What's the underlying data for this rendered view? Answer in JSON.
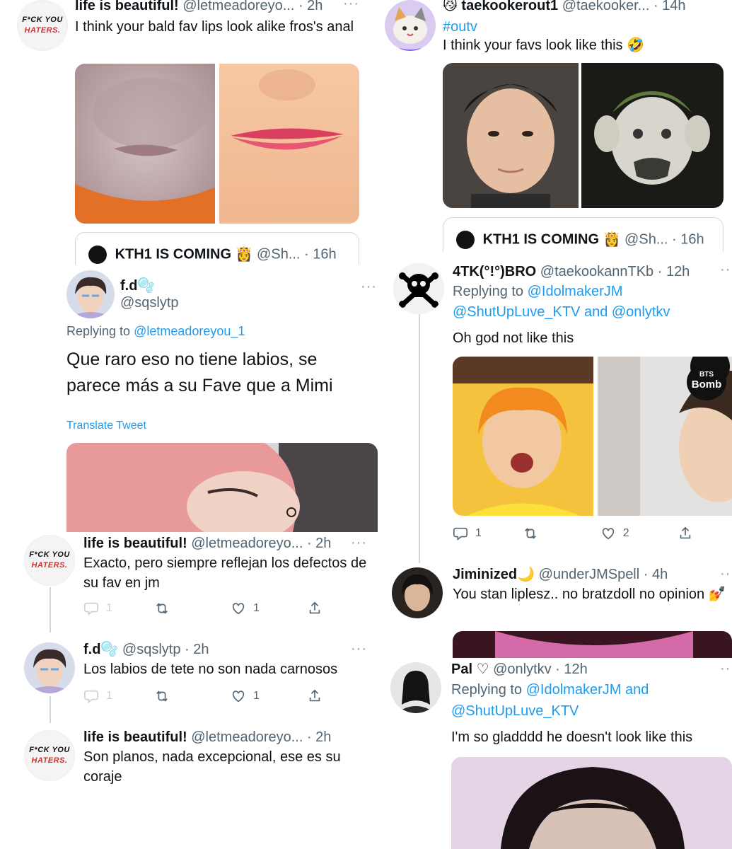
{
  "top_left": {
    "avatar_line1": "F*CK YOU",
    "avatar_line2": "HATERS.",
    "name": "life is beautiful!",
    "handle": "@letmeadoreyo... · 2h",
    "text": "I think your bald fav lips look alike fros's anal",
    "quote_name": "KTH1 IS COMING 👸",
    "quote_handle": "@Sh... · 16h"
  },
  "top_right": {
    "name": "😼 taekookerout1",
    "handle": "@taekooker... · 14h",
    "hashtag": "#outv",
    "text": "I think your favs  look like this 🤣",
    "quote_name": "KTH1 IS COMING 👸",
    "quote_handle": "@Sh... · 16h"
  },
  "mid_left": {
    "name": "f.d⁠🫧",
    "handle": "@sqslytp",
    "replying_prefix": "Replying to ",
    "replying_to": "@letmeadoreyou_1",
    "text": "Que raro eso no tiene labios, se parece más a su Fave que a Mimi",
    "translate": "Translate Tweet"
  },
  "mid_right": {
    "name": "4TK(°!°)BRO",
    "handle": "@taekookannTKb · 12h",
    "replying_prefix": "Replying to ",
    "replying_to_line1": "@IdolmakerJM",
    "replying_to_line2": "@ShutUpLuve_KTV and @onlytkv",
    "text": "Oh god not like this",
    "badge_line1": "BTS",
    "badge_line2": "Bomb",
    "reply_count": "1",
    "retweet_count": "",
    "like_count": "2"
  },
  "thread_left": [
    {
      "avatar_line1": "F*CK YOU",
      "avatar_line2": "HATERS.",
      "name": "life is beautiful!",
      "handle": "@letmeadoreyo... · 2h",
      "text": "Exacto, pero siempre reflejan los defectos de su fav en jm",
      "reply_count": "1",
      "like_count": "1"
    },
    {
      "name": "f.d🫧",
      "handle": "@sqslytp · 2h",
      "text": "Los labios de tete no son nada carnosos",
      "reply_count": "1",
      "like_count": "1"
    },
    {
      "avatar_line1": "F*CK YOU",
      "avatar_line2": "HATERS.",
      "name": "life is beautiful!",
      "handle": "@letmeadoreyo... · 2h",
      "text": "Son planos, nada excepcional, ese es su coraje"
    }
  ],
  "bottom_right": [
    {
      "name": "Jiminized🌙",
      "handle": "@underJMSpell · 4h",
      "text": "You stan liplesz.. no bratzdoll no opinion 💅"
    },
    {
      "name": "Pal ♡",
      "handle": "@onlytkv · 12h",
      "replying_prefix": "Replying to ",
      "replying_to_line1": "@IdolmakerJM and",
      "replying_to_line2": "@ShutUpLuve_KTV",
      "text": "I'm so gladddd he doesn't look like this"
    }
  ],
  "icons": {
    "reply": "reply-icon",
    "retweet": "retweet-icon",
    "like": "heart-icon",
    "share": "share-icon",
    "more": "more-dots-icon"
  },
  "colors": {
    "link": "#1d9bf0",
    "secondary_text": "#536471",
    "border": "#cfd9de"
  }
}
